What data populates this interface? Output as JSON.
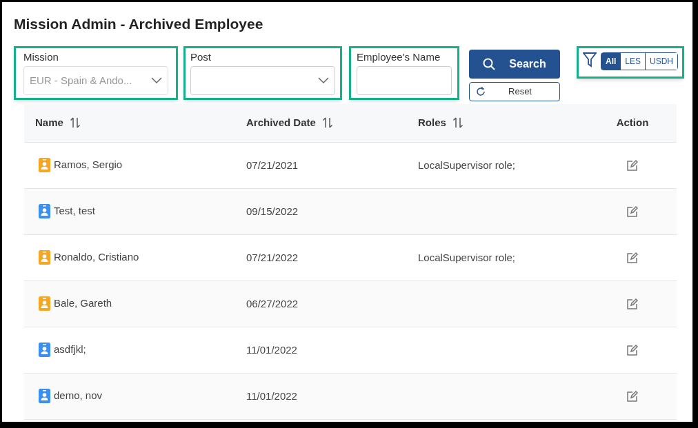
{
  "title": "Mission Admin - Archived Employee",
  "filters": {
    "mission": {
      "label": "Mission",
      "value": "EUR - Spain & Ando...",
      "disabled": true
    },
    "post": {
      "label": "Post"
    },
    "employee_name": {
      "label": "Employee's Name"
    }
  },
  "buttons": {
    "search": "Search",
    "reset": "Reset"
  },
  "type_toggle": [
    {
      "label": "All",
      "selected": true
    },
    {
      "label": "LES",
      "selected": false
    },
    {
      "label": "USDH",
      "selected": false
    }
  ],
  "table": {
    "columns": [
      {
        "label": "Name",
        "sortable": true
      },
      {
        "label": "Archived Date",
        "sortable": true
      },
      {
        "label": "Roles",
        "sortable": true
      },
      {
        "label": "Action",
        "sortable": false
      }
    ],
    "rows": [
      {
        "name": "Ramos, Sergio",
        "color": "#f5a623",
        "archived_date": "07/21/2021",
        "roles": "LocalSupervisor role;"
      },
      {
        "name": "Test, test",
        "color": "#3b8ff0",
        "archived_date": "09/15/2022"
      },
      {
        "name": "Ronaldo, Cristiano",
        "color": "#f5a623",
        "archived_date": "07/21/2022",
        "roles": "LocalSupervisor role;"
      },
      {
        "name": "Bale, Gareth",
        "color": "#f5a623",
        "archived_date": "06/27/2022"
      },
      {
        "name": "asdfjkl;",
        "color": "#3b8ff0",
        "archived_date": "11/01/2022"
      },
      {
        "name": "demo, nov",
        "color": "#3b8ff0",
        "archived_date": "11/01/2022"
      }
    ]
  }
}
